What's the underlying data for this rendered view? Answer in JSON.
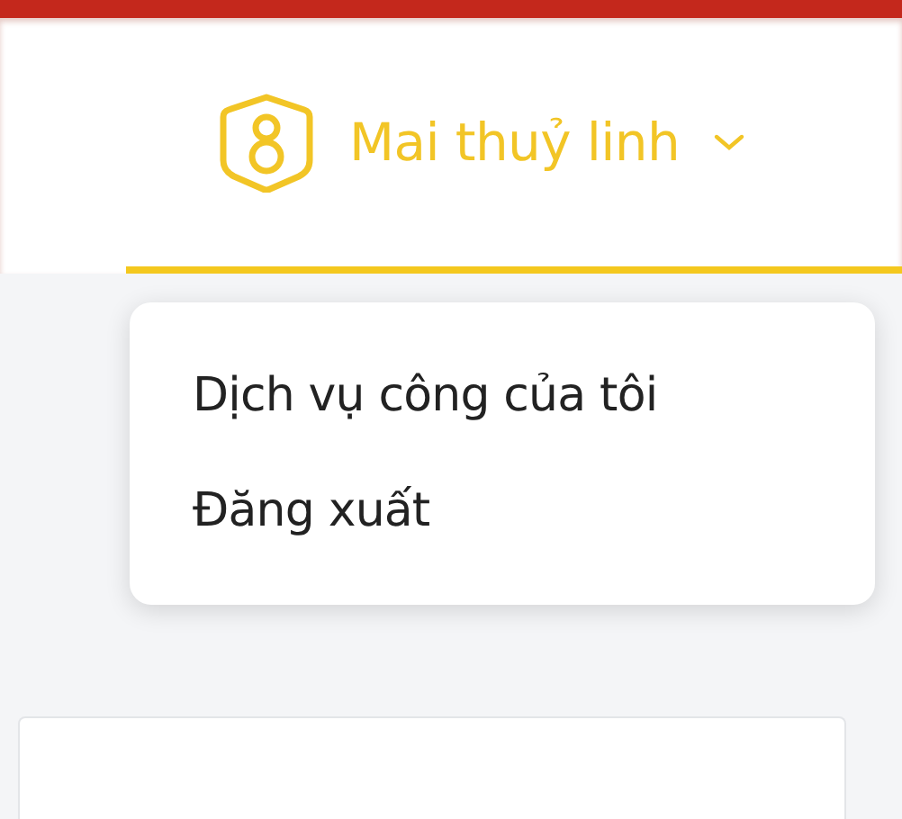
{
  "header": {
    "user_name": "Mai thuỷ linh"
  },
  "menu": {
    "expanded": true,
    "items": [
      {
        "label": "Dịch vụ công của tôi"
      },
      {
        "label": "Đăng xuất"
      }
    ]
  }
}
